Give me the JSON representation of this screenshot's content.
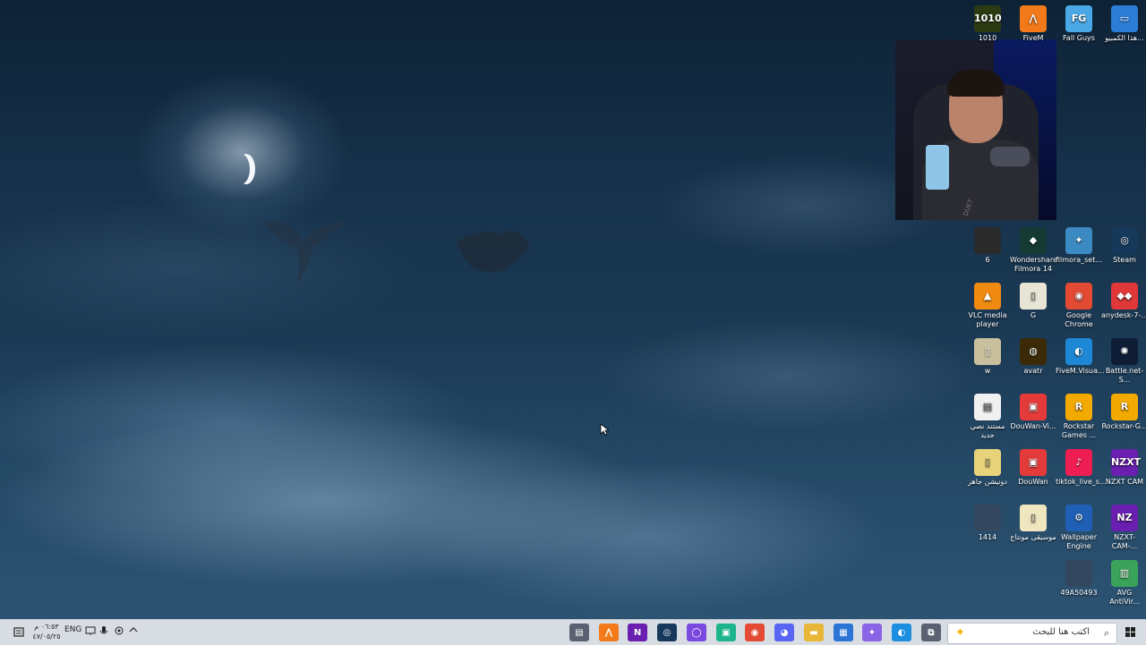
{
  "desktop": {
    "webcam_shirt_text": "DUET",
    "icons": [
      {
        "name": "icon-1010",
        "label": "1010",
        "color": "#2d3b12",
        "glyph": "1010"
      },
      {
        "name": "icon-fivem",
        "label": "FiveM",
        "color": "#f27a1a",
        "glyph": "⋀"
      },
      {
        "name": "icon-fall-guys",
        "label": "Fall Guys",
        "color": "#4aa8e6",
        "glyph": "FG"
      },
      {
        "name": "icon-this-pc",
        "label": "هذا الكمبيو...",
        "color": "#2b7dd6",
        "glyph": "▭"
      },
      {
        "name": "icon-6",
        "label": "6",
        "color": "#2a2a2a",
        "glyph": ""
      },
      {
        "name": "icon-filmora",
        "label": "Wondershare Filmora 14",
        "color": "#153a34",
        "glyph": "◆"
      },
      {
        "name": "icon-filmora-setup",
        "label": "filmora_set...",
        "color": "#3b8ac2",
        "glyph": "✦"
      },
      {
        "name": "icon-steam",
        "label": "Steam",
        "color": "#16395b",
        "glyph": "◎"
      },
      {
        "name": "icon-vlc",
        "label": "VLC media player",
        "color": "#f08a10",
        "glyph": "▲"
      },
      {
        "name": "icon-g",
        "label": "G",
        "color": "#e8e4d6",
        "glyph": "▯"
      },
      {
        "name": "icon-chrome",
        "label": "Google Chrome",
        "color": "#e24a33",
        "glyph": "◉"
      },
      {
        "name": "icon-anydesk",
        "label": "anydesk-7-...",
        "color": "#e03838",
        "glyph": "◆◆"
      },
      {
        "name": "icon-w",
        "label": "w",
        "color": "#c8bf9c",
        "glyph": "▯"
      },
      {
        "name": "icon-avatr",
        "label": "avatr",
        "color": "#3a2a08",
        "glyph": "◍"
      },
      {
        "name": "icon-fivem-visual",
        "label": "FiveM.Visua...",
        "color": "#1e88d6",
        "glyph": "◐"
      },
      {
        "name": "icon-battlenet",
        "label": "Battle.net-S...",
        "color": "#0e1c36",
        "glyph": "✺"
      },
      {
        "name": "icon-new-text",
        "label": "مستند نصي جديد",
        "color": "#f1f1f1",
        "glyph": "▤"
      },
      {
        "name": "icon-douwan-vi",
        "label": "DouWan-Vi...",
        "color": "#e53a3a",
        "glyph": "▣"
      },
      {
        "name": "icon-rockstar-games",
        "label": "Rockstar Games ...",
        "color": "#f2a900",
        "glyph": "R"
      },
      {
        "name": "icon-rockstar-g",
        "label": "Rockstar-G...",
        "color": "#f2a900",
        "glyph": "R"
      },
      {
        "name": "icon-donation-ready",
        "label": "دونيشن جاهز",
        "color": "#e8d37a",
        "glyph": "▯"
      },
      {
        "name": "icon-douwan",
        "label": "DouWan",
        "color": "#e53a3a",
        "glyph": "▣"
      },
      {
        "name": "icon-tiktok-live",
        "label": "tiktok_live_s...",
        "color": "#ee1d52",
        "glyph": "♪"
      },
      {
        "name": "icon-nzxt-cam",
        "label": "NZXT CAM",
        "color": "#6a1fb0",
        "glyph": "NZXT"
      },
      {
        "name": "icon-1414",
        "label": "1414",
        "color": "#33485e",
        "glyph": ""
      },
      {
        "name": "icon-music-montage",
        "label": "موسيقى مونتاج",
        "color": "#efe6c0",
        "glyph": "▯"
      },
      {
        "name": "icon-wallpaper-engine",
        "label": "Wallpaper Engine",
        "color": "#1f5fb5",
        "glyph": "⚙"
      },
      {
        "name": "icon-nzxt-cam-2",
        "label": "NZXT-CAM-...",
        "color": "#6a1fb0",
        "glyph": "NZ"
      },
      {
        "name": "icon-49a50493",
        "label": "49A50493",
        "color": "#33485e",
        "glyph": ""
      },
      {
        "name": "icon-avg",
        "label": "AVG AntiVir...",
        "color": "#3aa35a",
        "glyph": "▥"
      }
    ]
  },
  "taskbar": {
    "search_placeholder": "اكتب هنا للبحث",
    "clock_time": "٠٦:٥٣ م",
    "clock_date": "٤٧/٠٥/٢٥",
    "language": "ENG",
    "apps": [
      {
        "name": "taskbar-widgets",
        "color": "#5b6170",
        "glyph": "▤"
      },
      {
        "name": "taskbar-fivem",
        "color": "#f27a1a",
        "glyph": "⋀"
      },
      {
        "name": "taskbar-nzxt",
        "color": "#6a1fb0",
        "glyph": "N"
      },
      {
        "name": "taskbar-steam",
        "color": "#16395b",
        "glyph": "◎"
      },
      {
        "name": "taskbar-app-purple",
        "color": "#7a4ae0",
        "glyph": "◯"
      },
      {
        "name": "taskbar-app-green",
        "color": "#1cb48c",
        "glyph": "▣"
      },
      {
        "name": "taskbar-chrome",
        "color": "#e24a33",
        "glyph": "◉"
      },
      {
        "name": "taskbar-discord",
        "color": "#5865f2",
        "glyph": "◕"
      },
      {
        "name": "taskbar-file-explorer",
        "color": "#e8b73a",
        "glyph": "▬"
      },
      {
        "name": "taskbar-store",
        "color": "#2a74d6",
        "glyph": "▦"
      },
      {
        "name": "taskbar-copilot",
        "color": "#8a63e6",
        "glyph": "✦"
      },
      {
        "name": "taskbar-edge",
        "color": "#1c8ee0",
        "glyph": "◐"
      },
      {
        "name": "taskbar-task-view",
        "color": "#5b6170",
        "glyph": "⧉"
      }
    ]
  }
}
